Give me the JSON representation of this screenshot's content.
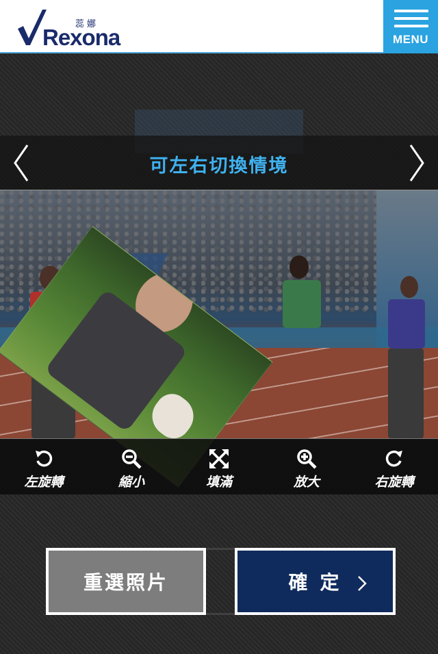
{
  "header": {
    "brand_cn": "蕊娜",
    "brand_name": "Rexona",
    "menu_label": "MENU"
  },
  "scene_switcher": {
    "label": "可左右切換情境",
    "prev_icon": "chevron-left-icon",
    "next_icon": "chevron-right-icon"
  },
  "toolbar": {
    "items": [
      {
        "label": "左旋轉",
        "icon": "rotate-left-icon"
      },
      {
        "label": "縮小",
        "icon": "zoom-out-icon"
      },
      {
        "label": "填滿",
        "icon": "fill-expand-icon"
      },
      {
        "label": "放大",
        "icon": "zoom-in-icon"
      },
      {
        "label": "右旋轉",
        "icon": "rotate-right-icon"
      }
    ]
  },
  "buttons": {
    "reselect_label": "重選照片",
    "confirm_label": "確定"
  },
  "colors": {
    "brand_navy": "#1a2b6b",
    "menu_blue": "#2aa3e0",
    "switch_text_blue": "#3fb2f0",
    "confirm_bg": "#0f2a5c",
    "reselect_bg": "#7d7d7d"
  }
}
